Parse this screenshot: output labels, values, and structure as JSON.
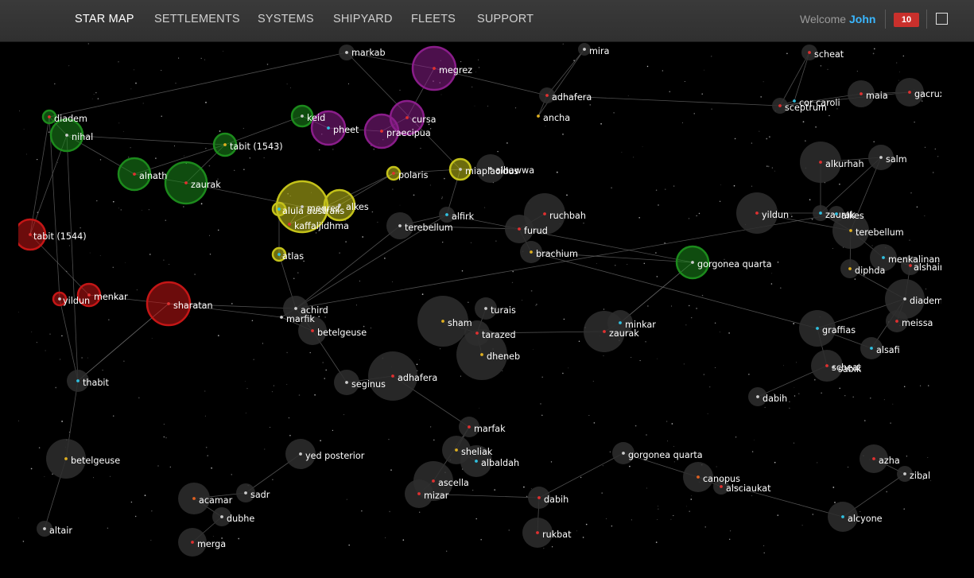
{
  "nav": {
    "items": [
      "STAR MAP",
      "SETTLEMENTS",
      "SYSTEMS",
      "SHIPYARD",
      "FLEETS",
      "SUPPORT"
    ],
    "active": "STAR MAP",
    "welcome_prefix": "Welcome",
    "user_name": "John",
    "notification_count": "10"
  },
  "colors": {
    "grey_halo": "#2e2e2e",
    "link_line": "#6a6a6a",
    "player_red": "#c41616",
    "player_green": "#1c8a1c",
    "player_purple": "#8a1d8a",
    "player_yellow": "#c4c21a",
    "user_name": "#3ab7ff",
    "badge": "#c9302c"
  },
  "map": {
    "stars": [
      {
        "label": "markab",
        "dot": "#cccccc"
      },
      {
        "label": "megrez",
        "dot": "#e03030"
      },
      {
        "label": "mira",
        "dot": "#cccccc"
      },
      {
        "label": "adhafera",
        "dot": "#e03030"
      },
      {
        "label": "ancha",
        "dot": "#e0b020"
      },
      {
        "label": "scheat",
        "dot": "#e03030"
      },
      {
        "label": "maia",
        "dot": "#e03030"
      },
      {
        "label": "gacrux",
        "dot": "#e03030"
      },
      {
        "label": "cor caroli",
        "dot": "#30c0e0"
      },
      {
        "label": "sceptrum",
        "dot": "#e03030"
      },
      {
        "label": "diadem",
        "dot": "#e03030"
      },
      {
        "label": "nihal",
        "dot": "#cccccc"
      },
      {
        "label": "keid",
        "dot": "#cccccc"
      },
      {
        "label": "pheet",
        "dot": "#30c0e0"
      },
      {
        "label": "cursa",
        "dot": "#e03030"
      },
      {
        "label": "praecipua",
        "dot": "#e03030"
      },
      {
        "label": "tabit (1543)",
        "dot": "#e0b020"
      },
      {
        "label": "alnath",
        "dot": "#e03030"
      },
      {
        "label": "zaurak",
        "dot": "#e03030"
      },
      {
        "label": "polaris",
        "dot": "#e03030"
      },
      {
        "label": "miaplacidus",
        "dot": "#cccccc"
      },
      {
        "label": "alhawwa",
        "dot": "#cccccc"
      },
      {
        "label": "alkurhah",
        "dot": "#e03030"
      },
      {
        "label": "salm",
        "dot": "#cccccc"
      },
      {
        "label": "tabit (1544)",
        "dot": "#e03030"
      },
      {
        "label": "alula australis",
        "dot": "#30c0e0"
      },
      {
        "label": "megrez",
        "dot": "#cccccc"
      },
      {
        "label": "alkes",
        "dot": "#cccccc"
      },
      {
        "label": "kaffaljidhma",
        "dot": "#e03030"
      },
      {
        "label": "alfirk",
        "dot": "#30c0e0"
      },
      {
        "label": "ruchbah",
        "dot": "#e03030"
      },
      {
        "label": "terebellum",
        "dot": "#cccccc"
      },
      {
        "label": "furud",
        "dot": "#e03030"
      },
      {
        "label": "yildun",
        "dot": "#e03030"
      },
      {
        "label": "zaurak",
        "dot": "#30c0e0"
      },
      {
        "label": "alkes",
        "dot": "#30c0e0"
      },
      {
        "label": "terebellum",
        "dot": "#e0b020"
      },
      {
        "label": "atlas",
        "dot": "#30c0e0"
      },
      {
        "label": "brachium",
        "dot": "#e0b020"
      },
      {
        "label": "gorgonea quarta",
        "dot": "#cccccc"
      },
      {
        "label": "menkalinan",
        "dot": "#30c0e0"
      },
      {
        "label": "alshain",
        "dot": "#e03030"
      },
      {
        "label": "diphda",
        "dot": "#e0b020"
      },
      {
        "label": "yildun",
        "dot": "#cccccc"
      },
      {
        "label": "menkar",
        "dot": "#e03030"
      },
      {
        "label": "sharatan",
        "dot": "#e03030"
      },
      {
        "label": "achird",
        "dot": "#cccccc"
      },
      {
        "label": "marfik",
        "dot": "#cccccc"
      },
      {
        "label": "turais",
        "dot": "#cccccc"
      },
      {
        "label": "diadem",
        "dot": "#cccccc"
      },
      {
        "label": "betelgeuse",
        "dot": "#e03030"
      },
      {
        "label": "sham",
        "dot": "#e0b020"
      },
      {
        "label": "tarazed",
        "dot": "#e03030"
      },
      {
        "label": "minkar",
        "dot": "#30c0e0"
      },
      {
        "label": "zaurak",
        "dot": "#e03030"
      },
      {
        "label": "meissa",
        "dot": "#e03030"
      },
      {
        "label": "graffias",
        "dot": "#30c0e0"
      },
      {
        "label": "alsafi",
        "dot": "#30c0e0"
      },
      {
        "label": "dheneb",
        "dot": "#e0b020"
      },
      {
        "label": "scheat",
        "dot": "#e03030"
      },
      {
        "label": "sabik",
        "dot": "#cccccc"
      },
      {
        "label": "thabit",
        "dot": "#30c0e0"
      },
      {
        "label": "seginus",
        "dot": "#cccccc"
      },
      {
        "label": "adhafera",
        "dot": "#e03030"
      },
      {
        "label": "dabih",
        "dot": "#cccccc"
      },
      {
        "label": "marfak",
        "dot": "#e03030"
      },
      {
        "label": "sheliak",
        "dot": "#e0b020"
      },
      {
        "label": "albaldah",
        "dot": "#30c0e0"
      },
      {
        "label": "betelgeuse",
        "dot": "#e0b020"
      },
      {
        "label": "yed posterior",
        "dot": "#cccccc"
      },
      {
        "label": "gorgonea quarta",
        "dot": "#cccccc"
      },
      {
        "label": "azha",
        "dot": "#e03030"
      },
      {
        "label": "zibal",
        "dot": "#cccccc"
      },
      {
        "label": "ascella",
        "dot": "#e03030"
      },
      {
        "label": "canopus",
        "dot": "#e06020"
      },
      {
        "label": "alsciaukat",
        "dot": "#e03030"
      },
      {
        "label": "sadr",
        "dot": "#cccccc"
      },
      {
        "label": "acamar",
        "dot": "#e06020"
      },
      {
        "label": "mizar",
        "dot": "#e03030"
      },
      {
        "label": "dabih",
        "dot": "#e03030"
      },
      {
        "label": "dubhe",
        "dot": "#cccccc"
      },
      {
        "label": "alcyone",
        "dot": "#30c0e0"
      },
      {
        "label": "altair",
        "dot": "#cccccc"
      },
      {
        "label": "rukbat",
        "dot": "#e03030"
      },
      {
        "label": "merga",
        "dot": "#e03030"
      }
    ]
  }
}
